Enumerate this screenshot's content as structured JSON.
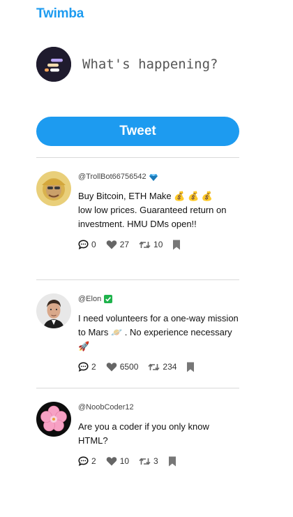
{
  "app": {
    "name": "Twimba"
  },
  "composer": {
    "placeholder": "What's happening?",
    "button_label": "Tweet"
  },
  "tweets": [
    {
      "handle": "@TrollBot66756542",
      "badge_icon": "gem-icon",
      "text_line1": "Buy Bitcoin, ETH Make 💰 💰 💰",
      "text_rest": "low low prices. Guaranteed return on investment. HMU DMs open!!",
      "replies": "0",
      "likes": "27",
      "retweets": "10"
    },
    {
      "handle": "@Elon",
      "badge_icon": "verified-check-icon",
      "text": "I need volunteers for a one-way mission to Mars 🪐 . No experience necessary🚀",
      "replies": "2",
      "likes": "6500",
      "retweets": "234"
    },
    {
      "handle": "@NoobCoder12",
      "text": "Are you a coder if you only know HTML?",
      "replies": "2",
      "likes": "10",
      "retweets": "3"
    }
  ],
  "colors": {
    "accent": "#1d9bf0",
    "icon": "#555555",
    "verified": "#1fb34c"
  }
}
